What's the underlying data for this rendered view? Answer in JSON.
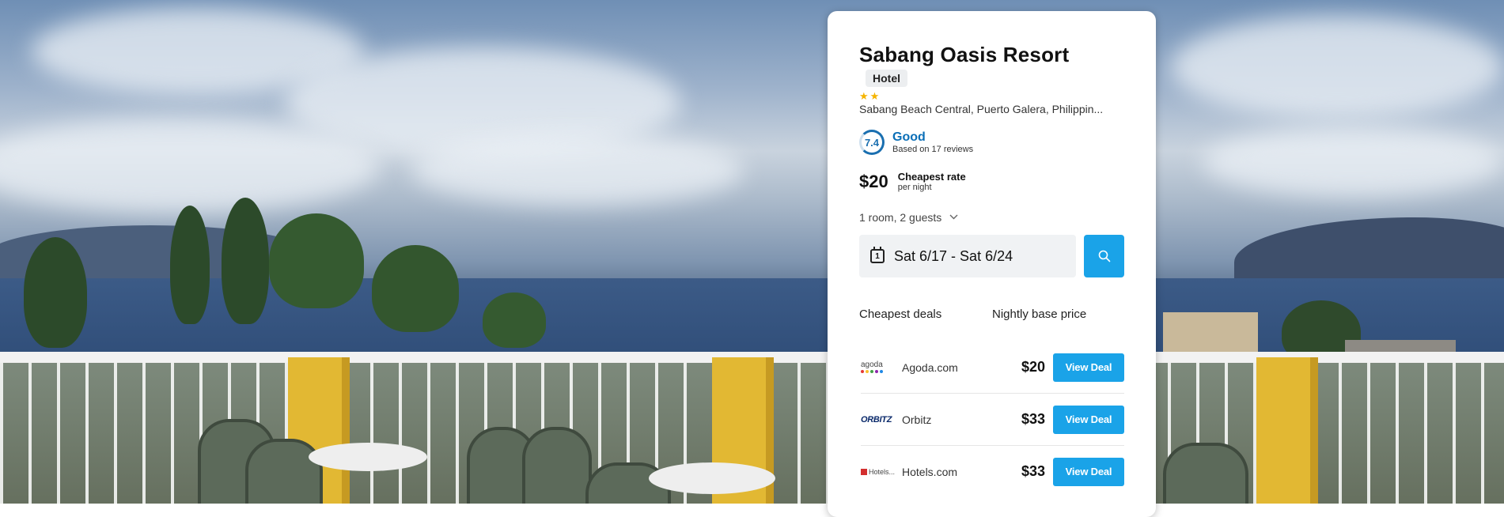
{
  "hotel": {
    "name": "Sabang Oasis Resort",
    "type_badge": "Hotel",
    "star_count": 2,
    "stars_display": "★★",
    "address": "Sabang Beach Central, Puerto Galera, Philippin..."
  },
  "rating": {
    "score": "7.4",
    "label": "Good",
    "reviews_text": "Based on 17 reviews"
  },
  "price": {
    "amount": "$20",
    "label": "Cheapest rate",
    "sub": "per night"
  },
  "search": {
    "guests": "1 room, 2 guests",
    "calendar_day": "1",
    "dates": "Sat 6/17 - Sat 6/24"
  },
  "deals": {
    "col_provider": "Cheapest deals",
    "col_price": "Nightly base price",
    "rows": [
      {
        "logo_text": "agoda",
        "provider": "Agoda.com",
        "price": "$20",
        "button": "View Deal"
      },
      {
        "logo_text": "ORBITZ",
        "provider": "Orbitz",
        "price": "$33",
        "button": "View Deal"
      },
      {
        "logo_text": "Hotels...",
        "provider": "Hotels.com",
        "price": "$33",
        "button": "View Deal"
      }
    ]
  },
  "colors": {
    "accent": "#1aa3e8",
    "rating_blue": "#0b6fb7",
    "star": "#f5b400"
  },
  "icons": [
    "star-icon",
    "calendar-icon",
    "search-icon",
    "chevron-down-icon"
  ]
}
